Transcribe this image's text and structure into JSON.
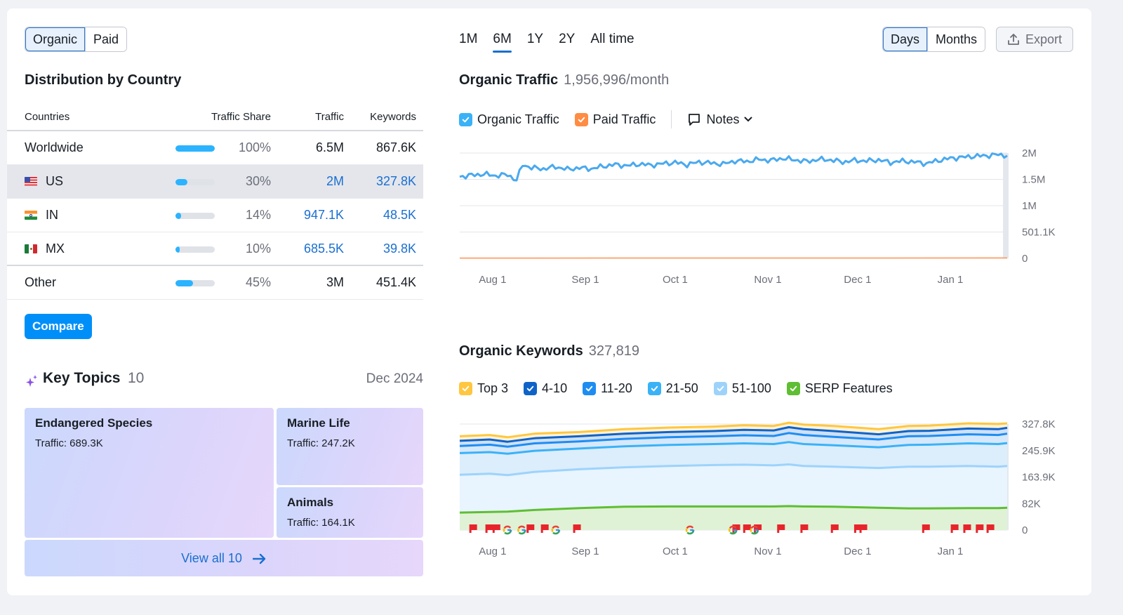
{
  "traffic_toggle": {
    "options": [
      "Organic",
      "Paid"
    ],
    "active": "Organic"
  },
  "country_section": {
    "title": "Distribution by Country",
    "columns": [
      "Countries",
      "Traffic Share",
      "Traffic",
      "Keywords"
    ],
    "rows": [
      {
        "name": "Worldwide",
        "flag": "",
        "share_pct": 100,
        "share": "100%",
        "traffic": "6.5M",
        "keywords": "867.6K",
        "link": false
      },
      {
        "name": "US",
        "flag": "us-flag",
        "share_pct": 30,
        "share": "30%",
        "traffic": "2M",
        "keywords": "327.8K",
        "link": true
      },
      {
        "name": "IN",
        "flag": "in-flag",
        "share_pct": 14,
        "share": "14%",
        "traffic": "947.1K",
        "keywords": "48.5K",
        "link": true
      },
      {
        "name": "MX",
        "flag": "mx-flag",
        "share_pct": 10,
        "share": "10%",
        "traffic": "685.5K",
        "keywords": "39.8K",
        "link": true
      },
      {
        "name": "Other",
        "flag": "",
        "share_pct": 45,
        "share": "45%",
        "traffic": "3M",
        "keywords": "451.4K",
        "link": false
      }
    ],
    "compare_label": "Compare"
  },
  "key_topics": {
    "title": "Key Topics",
    "count": "10",
    "date": "Dec 2024",
    "topics": [
      {
        "name": "Endangered Species",
        "traffic": "Traffic: 689.3K"
      },
      {
        "name": "Marine Life",
        "traffic": "Traffic: 247.2K"
      },
      {
        "name": "Animals",
        "traffic": "Traffic: 164.1K"
      }
    ],
    "view_all_label": "View all 10"
  },
  "range_tabs": {
    "options": [
      "1M",
      "6M",
      "1Y",
      "2Y",
      "All time"
    ],
    "active": "6M"
  },
  "granularity": {
    "options": [
      "Days",
      "Months"
    ],
    "active": "Days"
  },
  "export_label": "Export",
  "colors": {
    "accent": "#008ff8",
    "link": "#1a6fd0",
    "organic": "#4aa9ee",
    "paid": "#ff8c43",
    "top3": "#ffc640",
    "pos4_10": "#0f63c8",
    "pos11_20": "#1e8df2",
    "pos21_50": "#3ab2f7",
    "pos51_100": "#9dd3fb",
    "serp": "#5fbe33",
    "note_flag": "#e8242b"
  },
  "organic_traffic": {
    "title": "Organic Traffic",
    "value": "1,956,996/month",
    "legend": [
      {
        "label": "Organic Traffic",
        "color": "#3ab2f7",
        "checked": true
      },
      {
        "label": "Paid Traffic",
        "color": "#ff8c43",
        "checked": true
      }
    ],
    "notes_label": "Notes"
  },
  "organic_keywords": {
    "title": "Organic Keywords",
    "value": "327,819",
    "legend": [
      {
        "label": "Top 3",
        "color": "#ffc640",
        "checked": true
      },
      {
        "label": "4-10",
        "color": "#0f63c8",
        "checked": true
      },
      {
        "label": "11-20",
        "color": "#1e8df2",
        "checked": true
      },
      {
        "label": "21-50",
        "color": "#3ab2f7",
        "checked": true
      },
      {
        "label": "51-100",
        "color": "#9dd3fb",
        "checked": true
      },
      {
        "label": "SERP Features",
        "color": "#5fbe33",
        "checked": true
      }
    ]
  },
  "chart_data": [
    {
      "type": "line",
      "title": "Organic Traffic",
      "x_range": [
        "Jul 21",
        "Jan 20"
      ],
      "x_ticks": [
        "Aug 1",
        "Sep 1",
        "Oct 1",
        "Nov 1",
        "Dec 1",
        "Jan 1"
      ],
      "y_ticks": [
        "0",
        "501.1K",
        "1M",
        "1.5M",
        "2M"
      ],
      "ylim": [
        0,
        2000000
      ],
      "grid": true,
      "series": [
        {
          "name": "Organic Traffic",
          "x_day": [
            0,
            4,
            8,
            12,
            16,
            19,
            21,
            24,
            28,
            32,
            36,
            40,
            44,
            48,
            52,
            56,
            60,
            64,
            68,
            72,
            76,
            80,
            84,
            88,
            92,
            96,
            100,
            104,
            108,
            112,
            116,
            120,
            124,
            128,
            132,
            136,
            140,
            144,
            148,
            152,
            156,
            160,
            164,
            168,
            172,
            176,
            180,
            183
          ],
          "values": [
            1550000,
            1580000,
            1600000,
            1570000,
            1590000,
            1480000,
            1780000,
            1720000,
            1700000,
            1740000,
            1690000,
            1720000,
            1700000,
            1750000,
            1780000,
            1760000,
            1790000,
            1770000,
            1800000,
            1820000,
            1780000,
            1830000,
            1810000,
            1790000,
            1850000,
            1840000,
            1880000,
            1860000,
            1900000,
            1870000,
            1840000,
            1880000,
            1870000,
            1830000,
            1860000,
            1850000,
            1870000,
            1820000,
            1850000,
            1830000,
            1800000,
            1860000,
            1900000,
            1920000,
            1940000,
            1950000,
            1970000,
            1950000
          ]
        },
        {
          "name": "Paid Traffic",
          "x_day": [
            0,
            183
          ],
          "values": [
            5000,
            8000
          ]
        }
      ]
    },
    {
      "type": "area",
      "title": "Organic Keywords",
      "x_range": [
        "Jul 21",
        "Jan 20"
      ],
      "x_ticks": [
        "Aug 1",
        "Sep 1",
        "Oct 1",
        "Nov 1",
        "Dec 1",
        "Jan 1"
      ],
      "y_ticks": [
        "0",
        "82K",
        "163.9K",
        "245.9K",
        "327.8K"
      ],
      "ylim": [
        0,
        327800
      ],
      "grid": true,
      "x_day": [
        0,
        10,
        16,
        25,
        40,
        55,
        70,
        85,
        95,
        105,
        110,
        115,
        125,
        140,
        150,
        157,
        170,
        180,
        183
      ],
      "series": [
        {
          "name": "Top 3",
          "values": [
            290000,
            294000,
            287000,
            298000,
            303000,
            312000,
            317000,
            320000,
            324000,
            322000,
            332000,
            326000,
            322000,
            312000,
            322000,
            323000,
            330000,
            328000,
            330000
          ]
        },
        {
          "name": "4-10",
          "values": [
            276000,
            280000,
            273000,
            284000,
            290000,
            298000,
            303000,
            306000,
            310000,
            308000,
            318000,
            312000,
            306000,
            296000,
            306000,
            307000,
            314000,
            312000,
            316000
          ]
        },
        {
          "name": "11-20",
          "values": [
            260000,
            264000,
            258000,
            268000,
            274000,
            282000,
            287000,
            290000,
            293000,
            291000,
            300000,
            294000,
            288000,
            280000,
            290000,
            291000,
            296000,
            294000,
            298000
          ]
        },
        {
          "name": "21-50",
          "values": [
            238000,
            241000,
            236000,
            245000,
            252000,
            259000,
            263000,
            266000,
            268000,
            266000,
            272000,
            266000,
            262000,
            256000,
            263000,
            264000,
            268000,
            266000,
            269000
          ]
        },
        {
          "name": "51-100",
          "values": [
            171000,
            174000,
            170000,
            180000,
            188000,
            194000,
            198000,
            201000,
            202000,
            200000,
            203000,
            198000,
            196000,
            192000,
            196000,
            196000,
            198000,
            196000,
            198000
          ]
        },
        {
          "name": "SERP Features",
          "values": [
            54000,
            56000,
            57000,
            62000,
            68000,
            72000,
            73000,
            73000,
            73000,
            73000,
            74000,
            73000,
            72000,
            69000,
            67000,
            67000,
            68000,
            68000,
            69000
          ]
        }
      ],
      "annotations": {
        "note_flags_day": [
          3,
          12,
          16,
          35,
          43,
          61,
          150,
          156,
          162,
          175,
          188,
          205,
          218,
          221,
          256,
          272,
          279,
          286,
          292
        ],
        "google_updates_day": [
          22,
          30,
          49,
          124,
          148,
          160
        ]
      }
    }
  ]
}
